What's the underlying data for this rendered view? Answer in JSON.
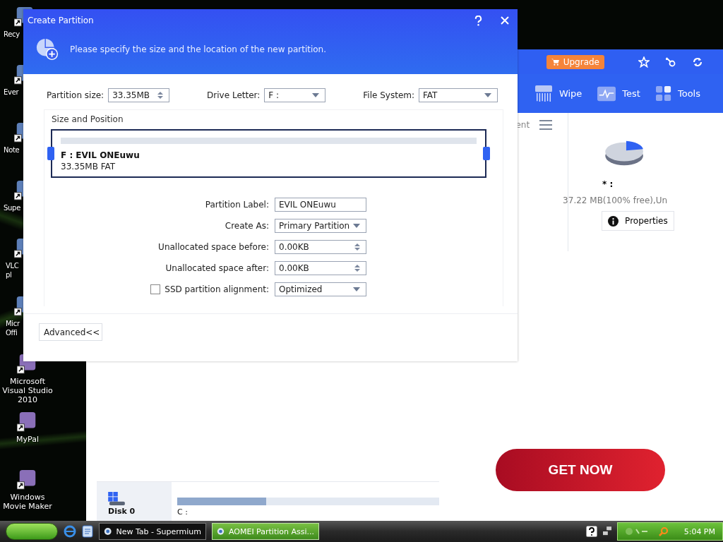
{
  "desktop": {
    "icons_behind_dialog": [
      {
        "label": "Recy"
      },
      {
        "label": "Ever"
      },
      {
        "label": "Note"
      },
      {
        "label": "Supe"
      },
      {
        "label": "VLC\npl"
      },
      {
        "label": "Micr\nOffi"
      }
    ],
    "icons": [
      {
        "label": "Microsoft Visual Studio 2010"
      },
      {
        "label": "MyPal"
      },
      {
        "label": "Windows Movie Maker"
      }
    ]
  },
  "app_window": {
    "upgrade_button": "Upgrade",
    "toolbar": [
      {
        "label": "Wipe",
        "kind": "wipe"
      },
      {
        "label": "Test",
        "kind": "test"
      },
      {
        "label": "Tools",
        "kind": "tools"
      }
    ],
    "tab_fragment": "ent",
    "disk_panel": {
      "drive_text": "* :",
      "info": "37.22 MB(100% free),Un",
      "properties_button": "Properties"
    },
    "disk_row": {
      "disk": "Disk 0",
      "partition": "C :",
      "level": 0.34
    }
  },
  "dialog": {
    "title": "Create Partition",
    "message": "Please specify the size and the location of the new partition.",
    "partition_size": {
      "label": "Partition size:",
      "value": "33.35MB"
    },
    "drive_letter": {
      "label": "Drive Letter:",
      "value": "F :"
    },
    "file_system": {
      "label": "File System:",
      "value": "FAT"
    },
    "section_title": "Size and Position",
    "partition_bar": {
      "name": "F : EVIL ONEuwu",
      "detail": "33.35MB FAT"
    },
    "rows": [
      {
        "kind": "text",
        "label": "Partition Label:",
        "value": "EVIL ONEuwu"
      },
      {
        "kind": "dropdown",
        "label": "Create As:",
        "value": "Primary Partition"
      },
      {
        "kind": "spinner",
        "label": "Unallocated space before:",
        "value": "0.00KB"
      },
      {
        "kind": "spinner",
        "label": "Unallocated space after:",
        "value": "0.00KB"
      },
      {
        "kind": "checkbox",
        "label": "SSD partition alignment:",
        "checked": false,
        "value": "Optimized"
      }
    ],
    "advanced_button": "Advanced<<"
  },
  "ad": {
    "button": "GET NOW"
  },
  "taskbar": {
    "tasks": [
      {
        "label": "New Tab - Supermium",
        "selected": false
      },
      {
        "label": "AOMEI Partition Assi...",
        "selected": true
      }
    ],
    "clock": "5:04 PM"
  }
}
